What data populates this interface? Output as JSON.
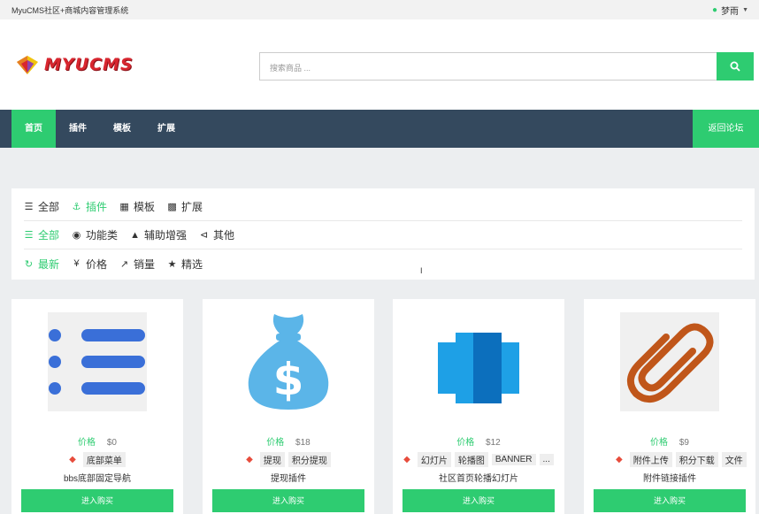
{
  "topbar": {
    "site_title": "MyuCMS社区+商城内容管理系统",
    "user_name": "梦雨"
  },
  "logo": {
    "text": "MYUCMS"
  },
  "search": {
    "placeholder": "搜索商品 ..."
  },
  "nav": {
    "items": [
      {
        "label": "首页",
        "active": true
      },
      {
        "label": "插件"
      },
      {
        "label": "模板"
      },
      {
        "label": "扩展"
      }
    ],
    "back_label": "返回论坛"
  },
  "filters": {
    "categories": [
      {
        "label": "全部",
        "icon": "list-icon"
      },
      {
        "label": "插件",
        "icon": "anchor-icon",
        "active": true
      },
      {
        "label": "模板",
        "icon": "windows-icon"
      },
      {
        "label": "扩展",
        "icon": "grid-icon"
      }
    ],
    "subcategories": [
      {
        "label": "全部",
        "icon": "list-icon",
        "active": true
      },
      {
        "label": "功能类",
        "icon": "dashboard-icon"
      },
      {
        "label": "辅助增强",
        "icon": "graduation-cap-icon"
      },
      {
        "label": "其他",
        "icon": "share-icon"
      }
    ],
    "sort": [
      {
        "label": "最新",
        "icon": "refresh-icon",
        "active": true
      },
      {
        "label": "价格",
        "icon": "yen-icon"
      },
      {
        "label": "销量",
        "icon": "line-chart-icon"
      },
      {
        "label": "精选",
        "icon": "star-icon"
      }
    ]
  },
  "products": [
    {
      "price_label": "价格",
      "price": "$0",
      "tags": [
        "底部菜单"
      ],
      "title": "bbs底部固定导航",
      "buy_label": "进入购买",
      "thumb": "list-menu-icon"
    },
    {
      "price_label": "价格",
      "price": "$18",
      "tags": [
        "提现",
        "积分提现"
      ],
      "title": "提现插件",
      "buy_label": "进入购买",
      "thumb": "money-bag-icon"
    },
    {
      "price_label": "价格",
      "price": "$12",
      "tags": [
        "幻灯片",
        "轮播图",
        "BANNER",
        "..."
      ],
      "title": "社区首页轮播幻灯片",
      "buy_label": "进入购买",
      "thumb": "carousel-icon"
    },
    {
      "price_label": "价格",
      "price": "$9",
      "tags": [
        "附件上传",
        "积分下载",
        "文件"
      ],
      "title": "附件链接插件",
      "buy_label": "进入购买",
      "thumb": "paperclip-icon"
    }
  ],
  "colors": {
    "accent": "#2ecc71",
    "nav_bg": "#34495e",
    "page_bg": "#eceef0"
  }
}
